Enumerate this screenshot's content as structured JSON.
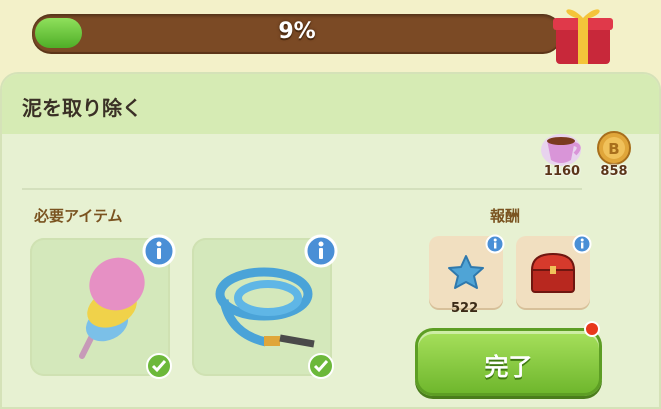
{
  "progress": {
    "value": 0.09,
    "label": "9%"
  },
  "panel": {
    "title": "泥を取り除く"
  },
  "resources": [
    {
      "icon": "teacup-icon",
      "value": "1160"
    },
    {
      "icon": "coin-icon",
      "value": "858"
    }
  ],
  "required": {
    "label": "必要アイテム",
    "items": [
      {
        "icon": "feather-duster-icon",
        "done": true
      },
      {
        "icon": "water-hose-icon",
        "done": true
      }
    ]
  },
  "rewards": {
    "label": "報酬",
    "items": [
      {
        "icon": "blue-star-icon",
        "count": "522"
      },
      {
        "icon": "red-chest-icon"
      }
    ]
  },
  "complete_button": {
    "label": "完了"
  },
  "colors": {
    "accent_green": "#6fb72d",
    "bar_brown": "#7b4a25"
  }
}
